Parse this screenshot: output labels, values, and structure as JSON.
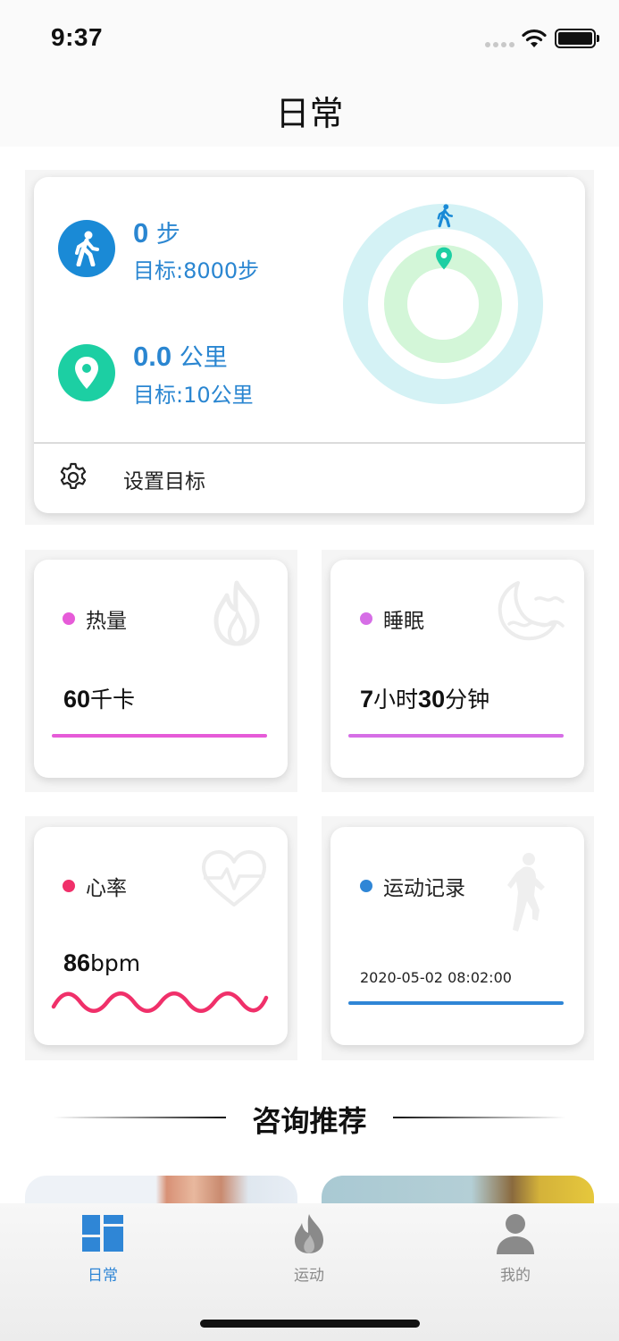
{
  "status_bar": {
    "time": "9:37"
  },
  "header": {
    "title": "日常"
  },
  "goal_card": {
    "steps_value": "0",
    "steps_unit": " 步",
    "steps_goal": "目标:8000步",
    "distance_value": "0.0",
    "distance_unit": " 公里",
    "distance_goal": "目标:10公里",
    "steps_progress": 0,
    "distance_progress": 0,
    "settings_label": "设置目标"
  },
  "tiles": {
    "calories": {
      "label": "热量",
      "value": "60",
      "unit": "千卡",
      "color": "#e65bd8"
    },
    "sleep": {
      "label": "睡眠",
      "value_hours": "7",
      "unit_hours": "小时",
      "value_minutes": "30",
      "unit_minutes": "分钟",
      "color": "#d66ee6"
    },
    "heart_rate": {
      "label": "心率",
      "value": "86",
      "unit": "bpm",
      "color": "#f0306a"
    },
    "exercise": {
      "label": "运动记录",
      "timestamp": "2020-05-02 08:02:00",
      "color": "#2f86d6"
    }
  },
  "section": {
    "title": "咨询推荐"
  },
  "tabbar": {
    "items": [
      {
        "label": "日常",
        "icon": "dashboard-icon",
        "active": true
      },
      {
        "label": "运动",
        "icon": "flame-icon",
        "active": false
      },
      {
        "label": "我的",
        "icon": "person-icon",
        "active": false
      }
    ],
    "active_color": "#2f86d6",
    "inactive_color": "#8a8a8a"
  },
  "colors": {
    "accent_blue": "#2a86d1",
    "steps_icon": "#1a8ad6",
    "distance_icon": "#1ccfa3",
    "ring_outer": "#d4f2f5",
    "ring_inner": "#d3f6d8"
  }
}
